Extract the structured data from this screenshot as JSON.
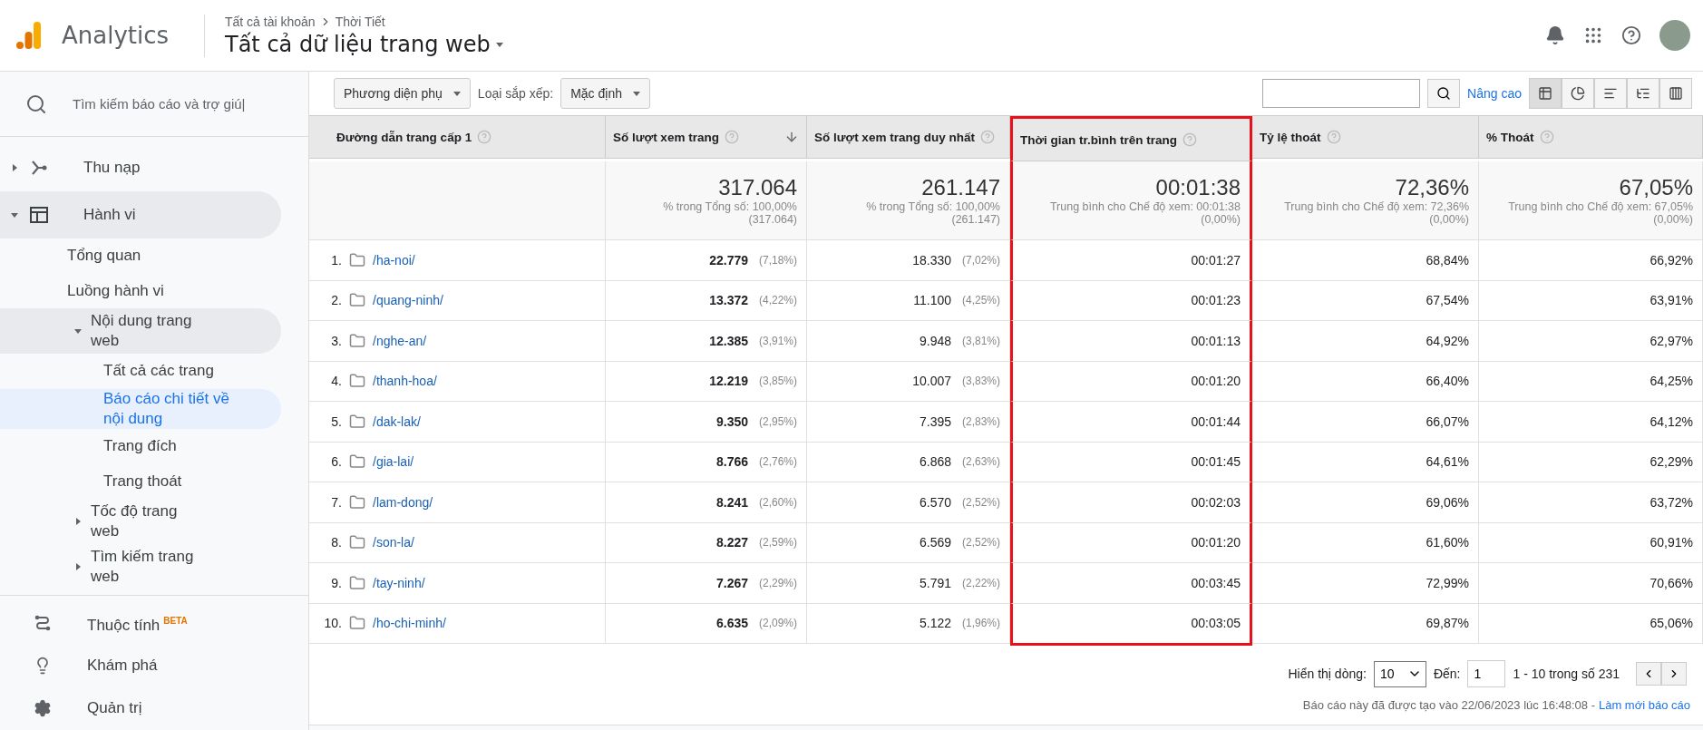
{
  "header": {
    "product": "Analytics",
    "breadcrumb": [
      "Tất cả tài khoản",
      "Thời Tiết"
    ],
    "view": "Tất cả dữ liệu trang web"
  },
  "sidebar": {
    "search_placeholder": "Tìm kiếm báo cáo và trợ giú|",
    "items": [
      {
        "label": "Thu nạp",
        "expanded": false,
        "selected": false
      },
      {
        "label": "Hành vi",
        "expanded": true,
        "selected": true,
        "children": [
          {
            "label": "Tổng quan",
            "selected": false
          },
          {
            "label": "Luồng hành vi",
            "selected": false
          },
          {
            "label": "Nội dung trang web",
            "expanded": true,
            "selected": true,
            "children": [
              {
                "label": "Tất cả các trang",
                "selected": false
              },
              {
                "label": "Báo cáo chi tiết về nội dung",
                "selected": true
              },
              {
                "label": "Trang đích",
                "selected": false
              },
              {
                "label": "Trang thoát",
                "selected": false
              }
            ]
          },
          {
            "label": "Tốc độ trang web",
            "expanded": false,
            "selected": false
          },
          {
            "label": "Tìm kiếm trang web",
            "expanded": false,
            "selected": false
          }
        ]
      }
    ],
    "bottom": [
      {
        "label": "Thuộc tính",
        "badge": "BETA"
      },
      {
        "label": "Khám phá"
      },
      {
        "label": "Quản trị"
      }
    ]
  },
  "toolbar": {
    "secondary_dimension": "Phương diện phụ",
    "sort_label": "Loại sắp xếp:",
    "sort_value": "Mặc định",
    "advanced_link": "Nâng cao"
  },
  "table": {
    "columns": [
      {
        "label": "Đường dẫn trang cấp 1",
        "sorted": false,
        "highlighted": false
      },
      {
        "label": "Số lượt xem trang",
        "sorted": true,
        "highlighted": false
      },
      {
        "label": "Số lượt xem trang duy nhất",
        "sorted": false,
        "highlighted": false
      },
      {
        "label": "Thời gian tr.bình trên trang",
        "sorted": false,
        "highlighted": true
      },
      {
        "label": "Tỷ lệ thoát",
        "sorted": false,
        "highlighted": false
      },
      {
        "label": "% Thoát",
        "sorted": false,
        "highlighted": false
      }
    ],
    "totals": [
      {
        "value": "317.064",
        "sub": "% trong Tổng số: 100,00%",
        "sub2": "(317.064)"
      },
      {
        "value": "261.147",
        "sub": "% trong Tổng số: 100,00%",
        "sub2": "(261.147)"
      },
      {
        "value": "00:01:38",
        "sub": "Trung bình cho Chế độ xem: 00:01:38",
        "sub2": "(0,00%)"
      },
      {
        "value": "72,36%",
        "sub": "Trung bình cho Chế độ xem: 72,36%",
        "sub2": "(0,00%)"
      },
      {
        "value": "67,05%",
        "sub": "Trung bình cho Chế độ xem: 67,05%",
        "sub2": "(0,00%)"
      }
    ],
    "rows": [
      {
        "index": "1.",
        "path": "/ha-noi/",
        "views": "22.779",
        "views_pct": "(7,18%)",
        "unique": "18.330",
        "unique_pct": "(7,02%)",
        "time": "00:01:27",
        "bounce": "68,84%",
        "exit": "66,92%"
      },
      {
        "index": "2.",
        "path": "/quang-ninh/",
        "views": "13.372",
        "views_pct": "(4,22%)",
        "unique": "11.100",
        "unique_pct": "(4,25%)",
        "time": "00:01:23",
        "bounce": "67,54%",
        "exit": "63,91%"
      },
      {
        "index": "3.",
        "path": "/nghe-an/",
        "views": "12.385",
        "views_pct": "(3,91%)",
        "unique": "9.948",
        "unique_pct": "(3,81%)",
        "time": "00:01:13",
        "bounce": "64,92%",
        "exit": "62,97%"
      },
      {
        "index": "4.",
        "path": "/thanh-hoa/",
        "views": "12.219",
        "views_pct": "(3,85%)",
        "unique": "10.007",
        "unique_pct": "(3,83%)",
        "time": "00:01:20",
        "bounce": "66,40%",
        "exit": "64,25%"
      },
      {
        "index": "5.",
        "path": "/dak-lak/",
        "views": "9.350",
        "views_pct": "(2,95%)",
        "unique": "7.395",
        "unique_pct": "(2,83%)",
        "time": "00:01:44",
        "bounce": "66,07%",
        "exit": "64,12%"
      },
      {
        "index": "6.",
        "path": "/gia-lai/",
        "views": "8.766",
        "views_pct": "(2,76%)",
        "unique": "6.868",
        "unique_pct": "(2,63%)",
        "time": "00:01:45",
        "bounce": "64,61%",
        "exit": "62,29%"
      },
      {
        "index": "7.",
        "path": "/lam-dong/",
        "views": "8.241",
        "views_pct": "(2,60%)",
        "unique": "6.570",
        "unique_pct": "(2,52%)",
        "time": "00:02:03",
        "bounce": "69,06%",
        "exit": "63,72%"
      },
      {
        "index": "8.",
        "path": "/son-la/",
        "views": "8.227",
        "views_pct": "(2,59%)",
        "unique": "6.569",
        "unique_pct": "(2,52%)",
        "time": "00:01:20",
        "bounce": "61,60%",
        "exit": "60,91%"
      },
      {
        "index": "9.",
        "path": "/tay-ninh/",
        "views": "7.267",
        "views_pct": "(2,29%)",
        "unique": "5.791",
        "unique_pct": "(2,22%)",
        "time": "00:03:45",
        "bounce": "72,99%",
        "exit": "70,66%"
      },
      {
        "index": "10.",
        "path": "/ho-chi-minh/",
        "views": "6.635",
        "views_pct": "(2,09%)",
        "unique": "5.122",
        "unique_pct": "(1,96%)",
        "time": "00:03:05",
        "bounce": "69,87%",
        "exit": "65,06%"
      }
    ]
  },
  "pagination": {
    "rows_label": "Hiển thị dòng:",
    "rows_value": "10",
    "goto_label": "Đến:",
    "goto_value": "1",
    "range": "1 - 10 trong số 231"
  },
  "footer": {
    "note": "Báo cáo này đã được tạo vào 22/06/2023 lúc 16:48:08 -",
    "refresh_link": "Làm mới báo cáo"
  }
}
